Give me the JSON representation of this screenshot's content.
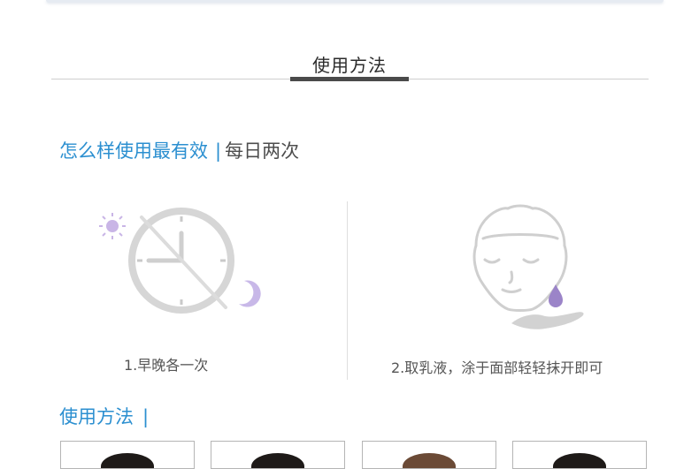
{
  "section": {
    "title": "使用方法"
  },
  "headline": {
    "highlight": "怎么样使用最有效",
    "separator": "|",
    "detail": "每日两次"
  },
  "steps": [
    {
      "caption": "1.早晚各一次",
      "icon": "clock-sun-moon-icon"
    },
    {
      "caption": "2.取乳液，涂于面部轻轻抹开即可",
      "icon": "face-lotion-drop-icon"
    }
  ],
  "method": {
    "title": "使用方法",
    "separator": "|"
  },
  "colors": {
    "accent": "#2b8fd0",
    "moon": "#c8b8e8",
    "drop": "#9b84c8",
    "line": "#cfcfcf"
  }
}
